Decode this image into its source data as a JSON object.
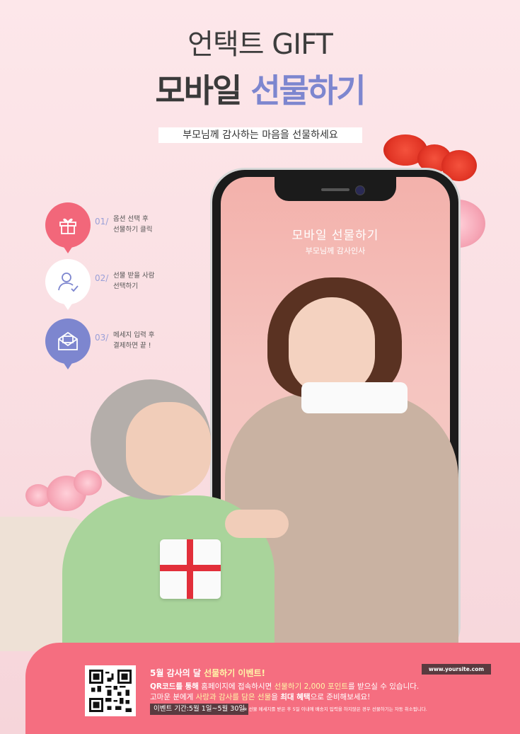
{
  "header": {
    "eyebrow": "언택트 GIFT",
    "headline_dark": "모바일",
    "headline_accent": "선물하기",
    "subline": "부모님께 감사하는 마음을 선물하세요"
  },
  "steps": [
    {
      "num": "01/",
      "text": "옵션 선택 후\n선물하기 클릭",
      "icon": "gift-icon"
    },
    {
      "num": "02/",
      "text": "선물 받을 사람\n선택하기",
      "icon": "user-check-icon"
    },
    {
      "num": "03/",
      "text": "메세지 입력 후\n결제하면 끝 !",
      "icon": "mail-icon"
    }
  ],
  "phone": {
    "screen_title": "모바일 선물하기",
    "screen_subtitle": "부모님께 감사인사"
  },
  "event": {
    "title_plain": "5월 감사의 달 ",
    "title_highlight": "선물하기 이벤트!",
    "line1_a": "QR코드를 통해",
    "line1_b": " 홈페이지에 접속하시면 ",
    "line1_c": "선물하기 2,000 포인트",
    "line1_d": "를 받으실 수 있습니다.",
    "line2_a": "고마운 분에게 ",
    "line2_b": "사랑과 감사를 담은 선물",
    "line2_c": "을 ",
    "line2_d": "최대 혜택",
    "line2_e": "으로 준비해보세요!",
    "period": "이벤트 기간:5월 1일~5월 30일",
    "note": "※ 선물 메세지를 받은 후 5일 이내에 배송지 입력을 하지않은 경우 선물하기는 자동 취소됩니다.",
    "site": "www.yoursite.com"
  },
  "colors": {
    "accent_blue": "#7d86cf",
    "accent_pink": "#f56e80",
    "background": "#fbe3e6"
  }
}
